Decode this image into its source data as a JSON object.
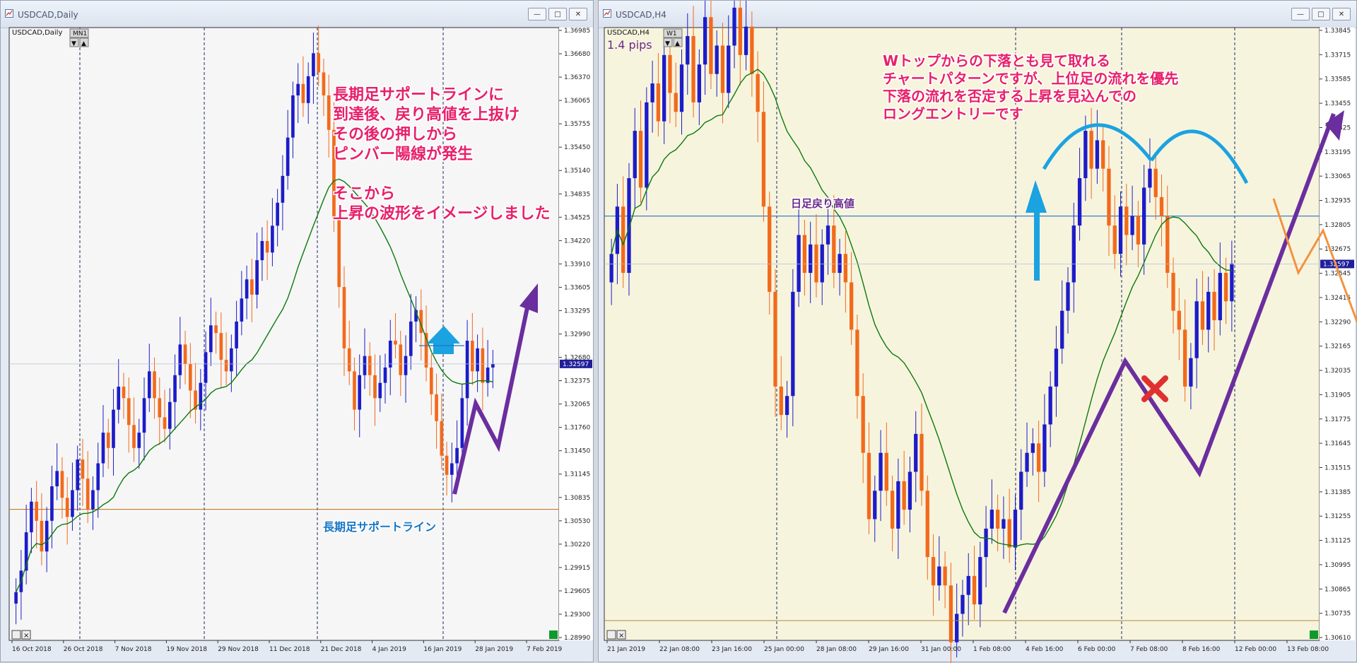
{
  "window1": {
    "title": "USDCAD,Daily",
    "chart_label": "USDCAD,Daily",
    "timeframe_button": "MN1",
    "current_price": "1.32597",
    "annotations": {
      "main": [
        "長期足サポートラインに",
        "到達後、戻り高値を上抜け",
        "その後の押しから",
        "ピンバー陽線が発生",
        "",
        "そこから",
        "上昇の波形をイメージしました"
      ],
      "support_label": "長期足サポートライン"
    }
  },
  "window2": {
    "title": "USDCAD,H4",
    "chart_label": "USDCAD,H4",
    "timeframe_button": "W1",
    "spread": "1.4 pips",
    "current_price": "1.32597",
    "annotations": {
      "main": [
        "Wトップからの下落とも見て取れる",
        "チャートパターンですが、上位足の流れを優先",
        "下落の流れを否定する上昇を見込んでの",
        "ロングエントリーです"
      ],
      "resistance_label": "日足戻り高値"
    }
  },
  "chart_data": [
    {
      "type": "candlestick",
      "symbol": "USDCAD",
      "timeframe": "Daily",
      "y_ticks": [
        "1.36985",
        "1.36680",
        "1.36370",
        "1.36065",
        "1.35755",
        "1.35450",
        "1.35140",
        "1.34835",
        "1.34525",
        "1.34220",
        "1.33910",
        "1.33605",
        "1.33295",
        "1.32990",
        "1.32680",
        "1.32375",
        "1.32065",
        "1.31760",
        "1.31450",
        "1.31145",
        "1.30835",
        "1.30530",
        "1.30220",
        "1.29915",
        "1.29605",
        "1.29300",
        "1.28990"
      ],
      "x_ticks": [
        "16 Oct 2018",
        "26 Oct 2018",
        "7 Nov 2018",
        "19 Nov 2018",
        "29 Nov 2018",
        "11 Dec 2018",
        "21 Dec 2018",
        "4 Jan 2019",
        "16 Jan 2019",
        "28 Jan 2019",
        "7 Feb 2019"
      ],
      "ylim": [
        1.2899,
        1.36985
      ],
      "current_price": 1.32597,
      "support_level": 1.307,
      "indicator": "moving average",
      "closes": [
        1.2962,
        1.299,
        1.304,
        1.308,
        1.3055,
        1.3015,
        1.3055,
        1.31,
        1.312,
        1.3085,
        1.306,
        1.3095,
        1.3135,
        1.311,
        1.307,
        1.3095,
        1.313,
        1.317,
        1.315,
        1.32,
        1.323,
        1.3215,
        1.318,
        1.315,
        1.317,
        1.3215,
        1.325,
        1.3215,
        1.319,
        1.3175,
        1.321,
        1.3245,
        1.3285,
        1.326,
        1.3225,
        1.32,
        1.3235,
        1.3275,
        1.331,
        1.33,
        1.3265,
        1.325,
        1.328,
        1.3315,
        1.3345,
        1.337,
        1.335,
        1.3395,
        1.342,
        1.3405,
        1.344,
        1.347,
        1.3505,
        1.3555,
        1.361,
        1.3625,
        1.36,
        1.3635,
        1.3665,
        1.364,
        1.361,
        1.3565,
        1.345,
        1.336,
        1.328,
        1.325,
        1.32,
        1.3245,
        1.327,
        1.3245,
        1.3215,
        1.3235,
        1.3255,
        1.329,
        1.3285,
        1.3245,
        1.327,
        1.3315,
        1.333,
        1.33,
        1.3255,
        1.322,
        1.3185,
        1.314,
        1.3115,
        1.313,
        1.315,
        1.3215,
        1.329,
        1.325,
        1.328,
        1.3235,
        1.3255,
        1.326
      ]
    },
    {
      "type": "candlestick",
      "symbol": "USDCAD",
      "timeframe": "H4",
      "y_ticks": [
        "1.33845",
        "1.33715",
        "1.33585",
        "1.33455",
        "1.33325",
        "1.33195",
        "1.33065",
        "1.32935",
        "1.32805",
        "1.32675",
        "1.32545",
        "1.32415",
        "1.32290",
        "1.32165",
        "1.32035",
        "1.31905",
        "1.31775",
        "1.31645",
        "1.31515",
        "1.31385",
        "1.31255",
        "1.31125",
        "1.30995",
        "1.30865",
        "1.30735",
        "1.30610"
      ],
      "x_ticks": [
        "21 Jan 2019",
        "22 Jan 08:00",
        "23 Jan 16:00",
        "25 Jan 00:00",
        "28 Jan 08:00",
        "29 Jan 16:00",
        "31 Jan 00:00",
        "1 Feb 08:00",
        "4 Feb 16:00",
        "6 Feb 00:00",
        "7 Feb 08:00",
        "8 Feb 16:00",
        "12 Feb 00:00",
        "13 Feb 08:00"
      ],
      "ylim": [
        1.3061,
        1.33845
      ],
      "current_price": 1.32597,
      "resistance_level": 1.3285,
      "indicator": "moving average",
      "closes": [
        1.3265,
        1.329,
        1.3255,
        1.3305,
        1.333,
        1.33,
        1.3345,
        1.3355,
        1.3335,
        1.337,
        1.335,
        1.334,
        1.3365,
        1.338,
        1.3345,
        1.3365,
        1.339,
        1.336,
        1.3375,
        1.335,
        1.3375,
        1.3395,
        1.337,
        1.3385,
        1.336,
        1.334,
        1.329,
        1.3245,
        1.3195,
        1.318,
        1.319,
        1.3245,
        1.3275,
        1.3255,
        1.327,
        1.325,
        1.327,
        1.328,
        1.3255,
        1.3265,
        1.325,
        1.3225,
        1.319,
        1.316,
        1.3125,
        1.314,
        1.316,
        1.314,
        1.312,
        1.3145,
        1.313,
        1.315,
        1.317,
        1.314,
        1.3105,
        1.309,
        1.31,
        1.309,
        1.306,
        1.3075,
        1.3085,
        1.3095,
        1.308,
        1.3105,
        1.312,
        1.313,
        1.312,
        1.3125,
        1.311,
        1.313,
        1.315,
        1.316,
        1.3165,
        1.315,
        1.3175,
        1.3195,
        1.3215,
        1.3235,
        1.325,
        1.328,
        1.3305,
        1.333,
        1.331,
        1.3325,
        1.331,
        1.328,
        1.3265,
        1.329,
        1.3275,
        1.3285,
        1.327,
        1.33,
        1.331,
        1.3295,
        1.3285,
        1.3255,
        1.3235,
        1.3225,
        1.3195,
        1.321,
        1.324,
        1.3225,
        1.3245,
        1.323,
        1.3255,
        1.324,
        1.326
      ]
    }
  ]
}
